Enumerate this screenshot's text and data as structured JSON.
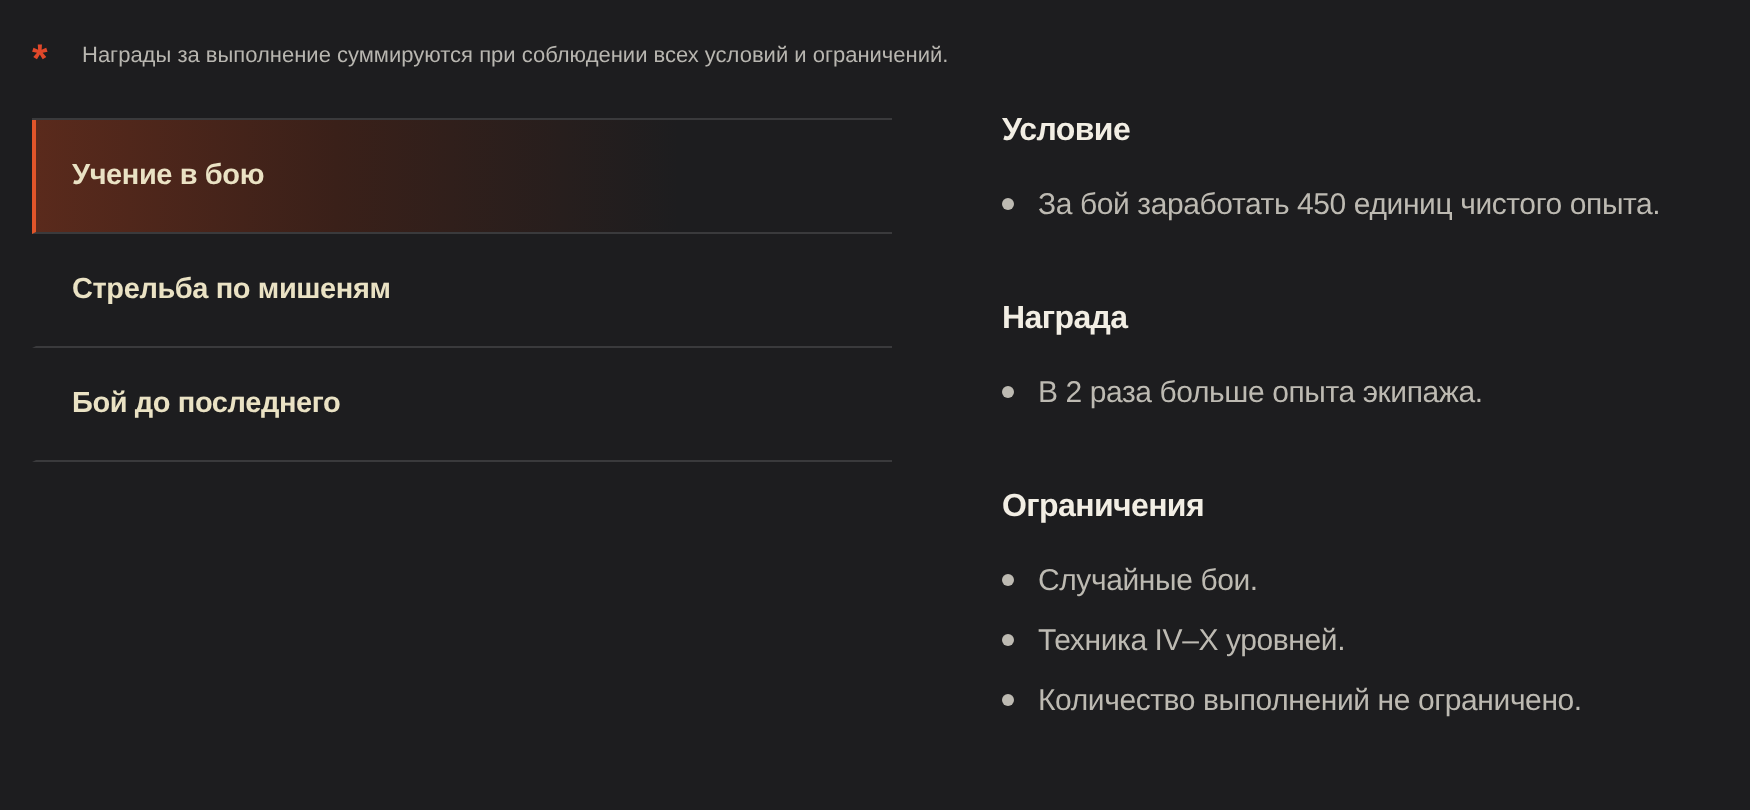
{
  "note": {
    "mark": "*",
    "text": "Награды за выполнение суммируются при соблюдении всех условий и ограничений."
  },
  "tabs": [
    {
      "label": "Учение в бою",
      "selected": true
    },
    {
      "label": "Стрельба по мишеням",
      "selected": false
    },
    {
      "label": "Бой до последнего",
      "selected": false
    }
  ],
  "sections": [
    {
      "title": "Условие",
      "items": [
        "За бой заработать 450 единиц чистого опыта."
      ]
    },
    {
      "title": "Награда",
      "items": [
        "В 2 раза больше опыта экипажа."
      ]
    },
    {
      "title": "Ограничения",
      "items": [
        "Случайные бои.",
        "Техника IV–X уровней.",
        "Количество выполнений не ограничено."
      ]
    }
  ]
}
